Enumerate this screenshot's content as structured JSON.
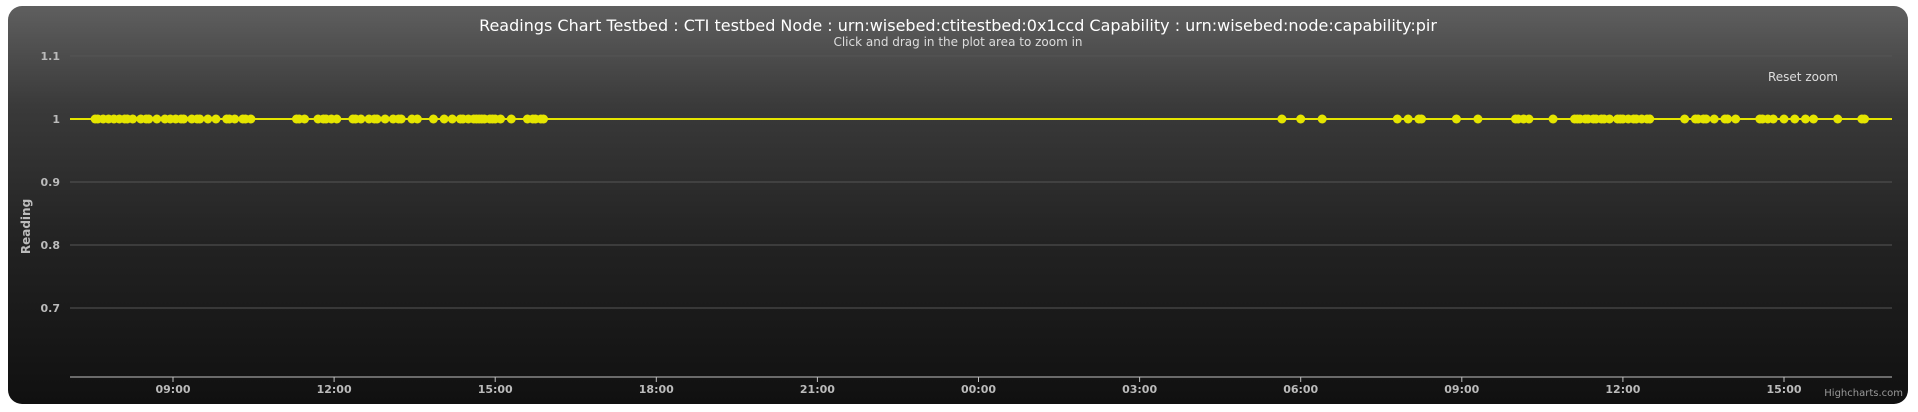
{
  "chart_data": {
    "type": "line",
    "title": "Readings Chart Testbed : CTI testbed Node : urn:wisebed:ctitestbed:0x1ccd Capability : urn:wisebed:node:capability:pir",
    "subtitle": "Click and drag in the plot area to zoom in",
    "ylabel": "Reading",
    "xlabel": "",
    "ylim": [
      0.6,
      1.1
    ],
    "yticks": [
      0.7,
      0.8,
      0.9,
      1,
      1.1
    ],
    "ytick_labels": [
      "0.7",
      "0.8",
      "0.9",
      "1",
      "1.1"
    ],
    "x_unit": "hours",
    "xlim": [
      7.08,
      16.92
    ],
    "xlim_comment": "",
    "xticks": [
      9,
      12,
      15,
      18,
      21,
      24,
      27,
      30,
      33,
      36,
      39
    ],
    "xtick_labels": [
      "09:00",
      "12:00",
      "15:00",
      "18:00",
      "21:00",
      "00:00",
      "03:00",
      "06:00",
      "09:00",
      "12:00",
      "15:00"
    ],
    "grid": true,
    "legend": "none",
    "series": [
      {
        "color": "#e5e500",
        "line_value": 1,
        "x": [
          7.55,
          7.6,
          7.7,
          7.8,
          7.9,
          8.0,
          8.1,
          8.15,
          8.25,
          8.4,
          8.5,
          8.55,
          8.7,
          8.85,
          8.95,
          9.05,
          9.15,
          9.2,
          9.35,
          9.45,
          9.5,
          9.65,
          9.8,
          10.0,
          10.05,
          10.15,
          10.3,
          10.35,
          10.45,
          11.3,
          11.35,
          11.45,
          11.7,
          11.8,
          11.85,
          11.95,
          12.05,
          12.35,
          12.4,
          12.5,
          12.65,
          12.75,
          12.8,
          12.95,
          13.1,
          13.2,
          13.25,
          13.45,
          13.55,
          13.85,
          14.05,
          14.2,
          14.35,
          14.4,
          14.5,
          14.6,
          14.65,
          14.7,
          14.75,
          14.8,
          14.9,
          14.95,
          15.0,
          15.1,
          15.3,
          15.6,
          15.7,
          15.75,
          15.85,
          15.9,
          29.65,
          30.0,
          30.4,
          31.8,
          32.0,
          32.2,
          32.25,
          32.9,
          33.3,
          34.0,
          34.05,
          34.15,
          34.25,
          34.7,
          35.1,
          35.15,
          35.2,
          35.3,
          35.35,
          35.45,
          35.5,
          35.6,
          35.65,
          35.75,
          35.9,
          35.95,
          36.0,
          36.1,
          36.2,
          36.25,
          36.35,
          36.45,
          36.5,
          37.15,
          37.35,
          37.4,
          37.5,
          37.55,
          37.7,
          37.9,
          37.95,
          38.1,
          38.55,
          38.6,
          38.7,
          38.8,
          39.0,
          39.2,
          39.4,
          39.55,
          40.0,
          40.45,
          40.5
        ],
        "y_value": 1
      }
    ]
  },
  "ui": {
    "reset_zoom_label": "Reset zoom",
    "credits_label": "Highcharts.com"
  }
}
